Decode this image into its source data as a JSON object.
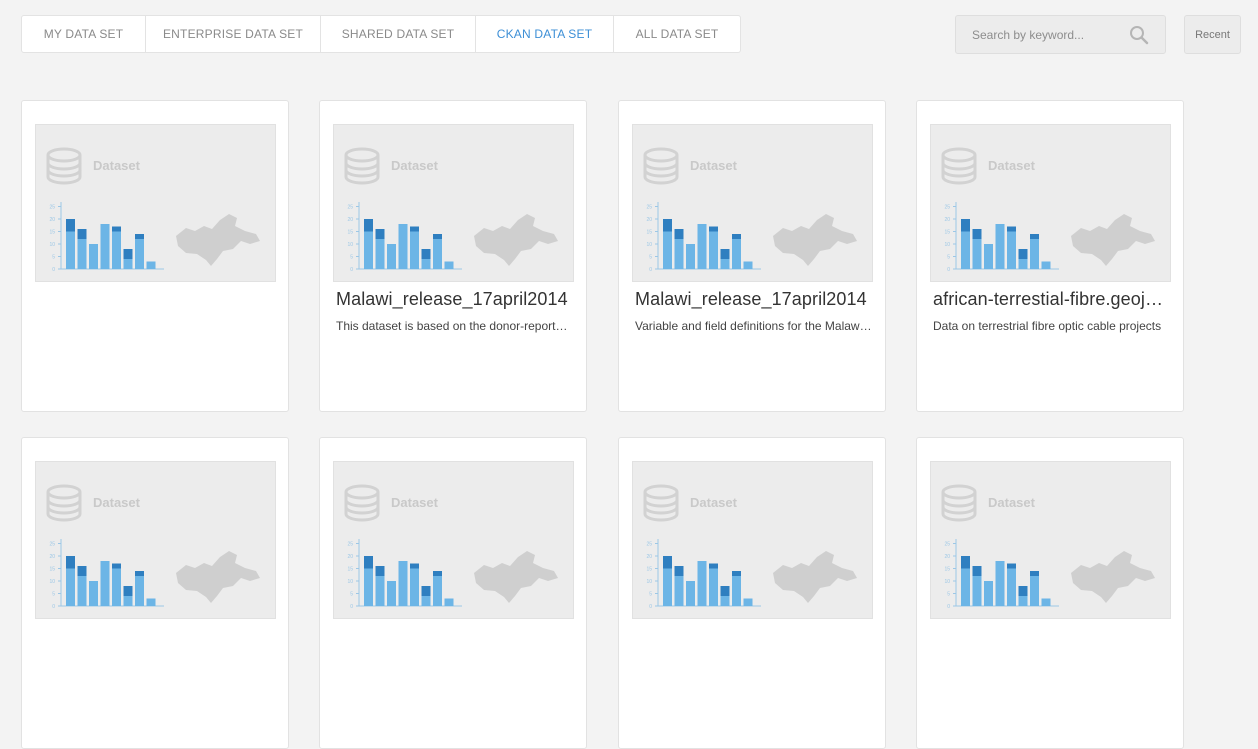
{
  "tabs": [
    {
      "label": "MY DATA SET",
      "active": false
    },
    {
      "label": "ENTERPRISE DATA SET",
      "active": false
    },
    {
      "label": "SHARED DATA SET",
      "active": false
    },
    {
      "label": "CKAN DATA SET",
      "active": true
    },
    {
      "label": "ALL DATA SET",
      "active": false
    }
  ],
  "search": {
    "placeholder": "Search by keyword...",
    "icon": "search-icon"
  },
  "recent_label": "Recent",
  "thumbnail": {
    "label": "Dataset",
    "icons": [
      "database-icon",
      "bar-chart-icon",
      "map-icon"
    ],
    "colors": {
      "bar_light": "#6cb5e6",
      "bar_dark": "#2f7fc0",
      "map": "#cfcfcf"
    }
  },
  "cards": [
    {
      "title": "",
      "description": ""
    },
    {
      "title": "Malawi_release_17april2014",
      "description": "This dataset is based on the donor-reported data"
    },
    {
      "title": "Malawi_release_17april2014",
      "description": "Variable and field definitions for the Malawi release"
    },
    {
      "title": "african-terrestial-fibre.geojson",
      "description": "Data on terrestrial fibre optic cable projects"
    },
    {
      "title": "",
      "description": ""
    },
    {
      "title": "",
      "description": ""
    },
    {
      "title": "",
      "description": ""
    },
    {
      "title": "",
      "description": ""
    }
  ]
}
